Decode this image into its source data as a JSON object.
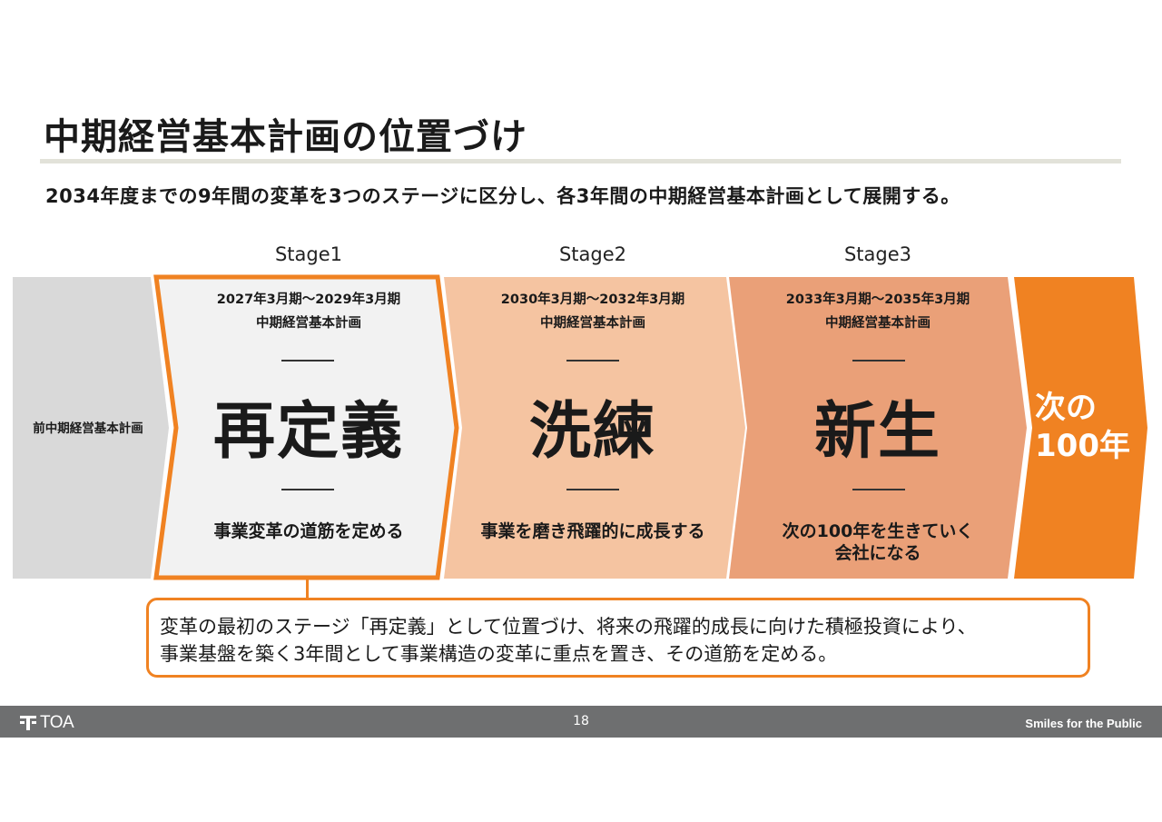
{
  "header": {
    "title": "中期経営基本計画の位置づけ",
    "subtitle": "2034年度までの9年間の変革を3つのステージに区分し、各3年間の中期経営基本計画として展開する。"
  },
  "roadmap": {
    "previous": "前中期経営基本計画",
    "stages": [
      {
        "label": "Stage1",
        "period": "2027年3月期～2029年3月期",
        "plan": "中期経営基本計画",
        "keyword": "再定義",
        "goal_line1": "事業変革の道筋を定める",
        "goal_line2": ""
      },
      {
        "label": "Stage2",
        "period": "2030年3月期～2032年3月期",
        "plan": "中期経営基本計画",
        "keyword": "洗練",
        "goal_line1": "事業を磨き飛躍的に成長する",
        "goal_line2": ""
      },
      {
        "label": "Stage3",
        "period": "2033年3月期～2035年3月期",
        "plan": "中期経営基本計画",
        "keyword": "新生",
        "goal_line1": "次の100年を生きていく",
        "goal_line2": "会社になる"
      }
    ],
    "next_line1": "次の",
    "next_line2": "100年"
  },
  "note": {
    "line1": "変革の最初のステージ「再定義」として位置づけ、将来の飛躍的成長に向けた積極投資により、",
    "line2": "事業基盤を築く3年間として事業構造の変革に重点を置き、その道筋を定める。"
  },
  "footer": {
    "logo_text": "TOA",
    "page_number": "18",
    "slogan": "Smiles for the Public"
  },
  "colors": {
    "accent": "#f08222",
    "previous": "#d9d9d9",
    "stage1_fill": "#f2f2f2",
    "stage2_fill": "#f5c4a1",
    "stage3_fill": "#eaa078",
    "next_fill": "#f08222",
    "footer": "#6e6f70"
  },
  "icons": {
    "logo": "toa-logo-icon"
  }
}
